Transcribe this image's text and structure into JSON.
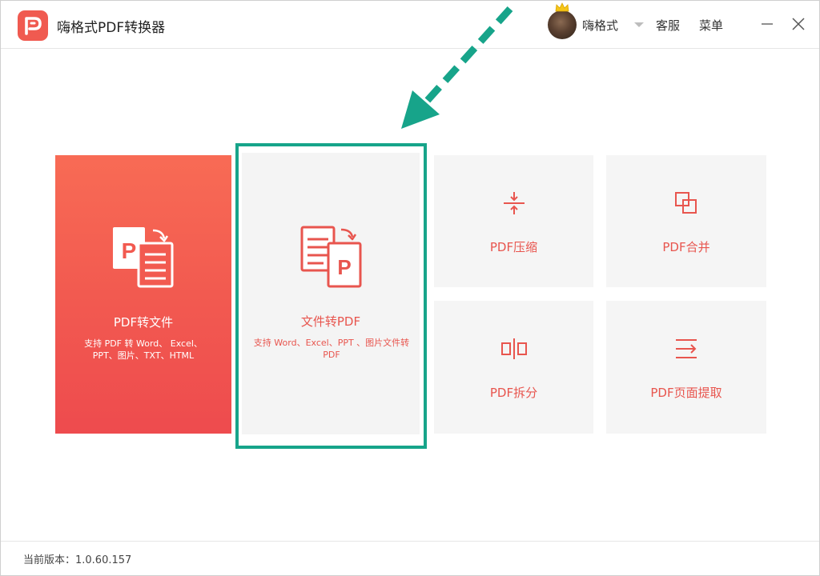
{
  "app": {
    "title": "嗨格式PDF转换器",
    "accent": "#f05a50",
    "highlight_color": "#17a48a"
  },
  "header": {
    "username": "嗨格式",
    "service_label": "客服",
    "menu_label": "菜单"
  },
  "cards": {
    "pdf_to_file": {
      "label": "PDF转文件",
      "desc": "支持 PDF 转 Word、 Excel、 PPT、图片、TXT、HTML",
      "icon": "pdf-to-file-icon"
    },
    "file_to_pdf": {
      "label": "文件转PDF",
      "desc": "支持 Word、Excel、PPT 、图片文件转 PDF",
      "icon": "file-to-pdf-icon"
    },
    "compress": {
      "label": "PDF压缩",
      "icon": "compress-icon"
    },
    "merge": {
      "label": "PDF合并",
      "icon": "merge-icon"
    },
    "split": {
      "label": "PDF拆分",
      "icon": "split-icon"
    },
    "extract": {
      "label": "PDF页面提取",
      "icon": "extract-icon"
    }
  },
  "footer": {
    "version": "当前版本：1.0.60.157"
  }
}
